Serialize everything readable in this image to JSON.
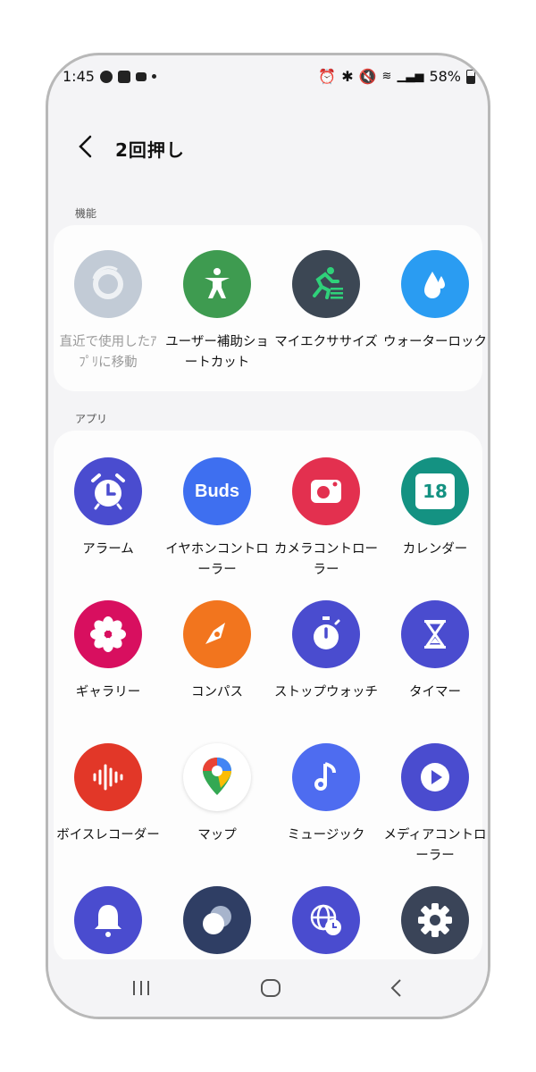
{
  "status": {
    "time": "1:45",
    "battery": "58%"
  },
  "header": {
    "title": "2回押し"
  },
  "sections": {
    "features_label": "機能",
    "apps_label": "アプリ"
  },
  "features": [
    {
      "label": "直近で使用したｱﾌﾟﾘに移動",
      "icon": "recent-apps-icon",
      "color": "#c2cbd6"
    },
    {
      "label": "ユーザー補助ショートカット",
      "icon": "accessibility-icon",
      "color": "#3e9b50"
    },
    {
      "label": "マイエクササイズ",
      "icon": "exercise-icon",
      "color": "#3c4754"
    },
    {
      "label": "ウォーターロック",
      "icon": "water-drop-icon",
      "color": "#2a9cf2"
    }
  ],
  "apps": [
    {
      "label": "アラーム",
      "icon": "alarm-icon",
      "color": "#4a4ccf"
    },
    {
      "label": "イヤホンコントローラー",
      "icon": "buds-icon",
      "color": "#3e6ff0",
      "text": "Buds"
    },
    {
      "label": "カメラコントローラー",
      "icon": "camera-icon",
      "color": "#e3304f"
    },
    {
      "label": "カレンダー",
      "icon": "calendar-icon",
      "color": "#149282",
      "text": "18"
    },
    {
      "label": "ギャラリー",
      "icon": "gallery-icon",
      "color": "#d80f5f"
    },
    {
      "label": "コンパス",
      "icon": "compass-icon",
      "color": "#f2751e"
    },
    {
      "label": "ストップウォッチ",
      "icon": "stopwatch-icon",
      "color": "#4a4ccf"
    },
    {
      "label": "タイマー",
      "icon": "timer-icon",
      "color": "#4a4ccf"
    },
    {
      "label": "ボイスレコーダー",
      "icon": "voice-recorder-icon",
      "color": "#e23728"
    },
    {
      "label": "マップ",
      "icon": "maps-icon",
      "color": "#ffffff"
    },
    {
      "label": "ミュージック",
      "icon": "music-icon",
      "color": "#4e6cf0"
    },
    {
      "label": "メディアコントローラー",
      "icon": "media-controller-icon",
      "color": "#4a4ccf"
    },
    {
      "label": "",
      "icon": "bell-icon",
      "color": "#4a4ccf"
    },
    {
      "label": "",
      "icon": "modes-icon",
      "color": "#2f3e64"
    },
    {
      "label": "",
      "icon": "world-clock-icon",
      "color": "#4a4ccf"
    },
    {
      "label": "",
      "icon": "settings-icon",
      "color": "#3a4458"
    }
  ]
}
